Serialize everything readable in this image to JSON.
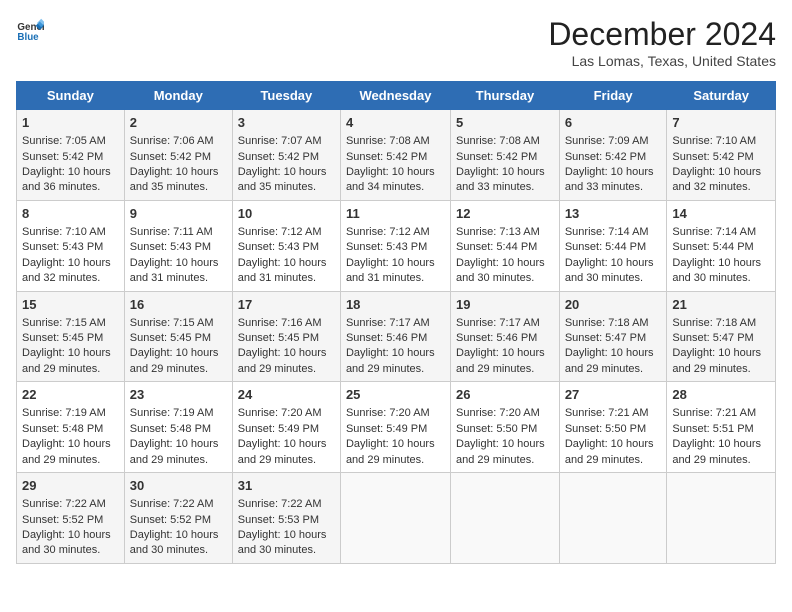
{
  "logo": {
    "line1": "General",
    "line2": "Blue"
  },
  "title": "December 2024",
  "location": "Las Lomas, Texas, United States",
  "days_of_week": [
    "Sunday",
    "Monday",
    "Tuesday",
    "Wednesday",
    "Thursday",
    "Friday",
    "Saturday"
  ],
  "weeks": [
    [
      {
        "day": "1",
        "sunrise": "7:05 AM",
        "sunset": "5:42 PM",
        "daylight": "10 hours and 36 minutes."
      },
      {
        "day": "2",
        "sunrise": "7:06 AM",
        "sunset": "5:42 PM",
        "daylight": "10 hours and 35 minutes."
      },
      {
        "day": "3",
        "sunrise": "7:07 AM",
        "sunset": "5:42 PM",
        "daylight": "10 hours and 35 minutes."
      },
      {
        "day": "4",
        "sunrise": "7:08 AM",
        "sunset": "5:42 PM",
        "daylight": "10 hours and 34 minutes."
      },
      {
        "day": "5",
        "sunrise": "7:08 AM",
        "sunset": "5:42 PM",
        "daylight": "10 hours and 33 minutes."
      },
      {
        "day": "6",
        "sunrise": "7:09 AM",
        "sunset": "5:42 PM",
        "daylight": "10 hours and 33 minutes."
      },
      {
        "day": "7",
        "sunrise": "7:10 AM",
        "sunset": "5:42 PM",
        "daylight": "10 hours and 32 minutes."
      }
    ],
    [
      {
        "day": "8",
        "sunrise": "7:10 AM",
        "sunset": "5:43 PM",
        "daylight": "10 hours and 32 minutes."
      },
      {
        "day": "9",
        "sunrise": "7:11 AM",
        "sunset": "5:43 PM",
        "daylight": "10 hours and 31 minutes."
      },
      {
        "day": "10",
        "sunrise": "7:12 AM",
        "sunset": "5:43 PM",
        "daylight": "10 hours and 31 minutes."
      },
      {
        "day": "11",
        "sunrise": "7:12 AM",
        "sunset": "5:43 PM",
        "daylight": "10 hours and 31 minutes."
      },
      {
        "day": "12",
        "sunrise": "7:13 AM",
        "sunset": "5:44 PM",
        "daylight": "10 hours and 30 minutes."
      },
      {
        "day": "13",
        "sunrise": "7:14 AM",
        "sunset": "5:44 PM",
        "daylight": "10 hours and 30 minutes."
      },
      {
        "day": "14",
        "sunrise": "7:14 AM",
        "sunset": "5:44 PM",
        "daylight": "10 hours and 30 minutes."
      }
    ],
    [
      {
        "day": "15",
        "sunrise": "7:15 AM",
        "sunset": "5:45 PM",
        "daylight": "10 hours and 29 minutes."
      },
      {
        "day": "16",
        "sunrise": "7:15 AM",
        "sunset": "5:45 PM",
        "daylight": "10 hours and 29 minutes."
      },
      {
        "day": "17",
        "sunrise": "7:16 AM",
        "sunset": "5:45 PM",
        "daylight": "10 hours and 29 minutes."
      },
      {
        "day": "18",
        "sunrise": "7:17 AM",
        "sunset": "5:46 PM",
        "daylight": "10 hours and 29 minutes."
      },
      {
        "day": "19",
        "sunrise": "7:17 AM",
        "sunset": "5:46 PM",
        "daylight": "10 hours and 29 minutes."
      },
      {
        "day": "20",
        "sunrise": "7:18 AM",
        "sunset": "5:47 PM",
        "daylight": "10 hours and 29 minutes."
      },
      {
        "day": "21",
        "sunrise": "7:18 AM",
        "sunset": "5:47 PM",
        "daylight": "10 hours and 29 minutes."
      }
    ],
    [
      {
        "day": "22",
        "sunrise": "7:19 AM",
        "sunset": "5:48 PM",
        "daylight": "10 hours and 29 minutes."
      },
      {
        "day": "23",
        "sunrise": "7:19 AM",
        "sunset": "5:48 PM",
        "daylight": "10 hours and 29 minutes."
      },
      {
        "day": "24",
        "sunrise": "7:20 AM",
        "sunset": "5:49 PM",
        "daylight": "10 hours and 29 minutes."
      },
      {
        "day": "25",
        "sunrise": "7:20 AM",
        "sunset": "5:49 PM",
        "daylight": "10 hours and 29 minutes."
      },
      {
        "day": "26",
        "sunrise": "7:20 AM",
        "sunset": "5:50 PM",
        "daylight": "10 hours and 29 minutes."
      },
      {
        "day": "27",
        "sunrise": "7:21 AM",
        "sunset": "5:50 PM",
        "daylight": "10 hours and 29 minutes."
      },
      {
        "day": "28",
        "sunrise": "7:21 AM",
        "sunset": "5:51 PM",
        "daylight": "10 hours and 29 minutes."
      }
    ],
    [
      {
        "day": "29",
        "sunrise": "7:22 AM",
        "sunset": "5:52 PM",
        "daylight": "10 hours and 30 minutes."
      },
      {
        "day": "30",
        "sunrise": "7:22 AM",
        "sunset": "5:52 PM",
        "daylight": "10 hours and 30 minutes."
      },
      {
        "day": "31",
        "sunrise": "7:22 AM",
        "sunset": "5:53 PM",
        "daylight": "10 hours and 30 minutes."
      },
      null,
      null,
      null,
      null
    ]
  ],
  "labels": {
    "sunrise_label": "Sunrise:",
    "sunset_label": "Sunset:",
    "daylight_label": "Daylight:"
  }
}
